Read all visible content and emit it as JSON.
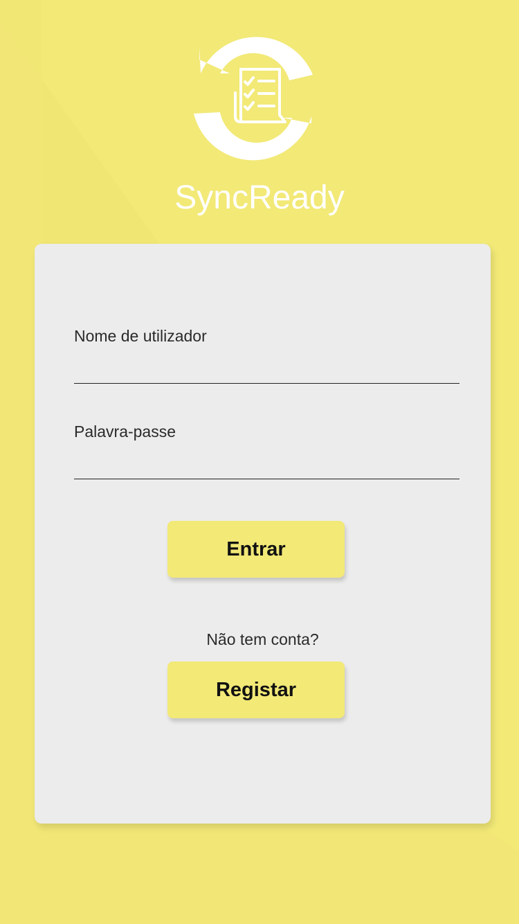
{
  "app": {
    "name": "SyncReady",
    "logo_icon": "sync-checklist-icon"
  },
  "login": {
    "username_label": "Nome de utilizador",
    "username_value": "",
    "password_label": "Palavra-passe",
    "password_value": "",
    "submit_label": "Entrar",
    "no_account_text": "Não tem conta?",
    "register_label": "Registar"
  },
  "colors": {
    "background": "#f2e977",
    "card": "#ececec",
    "button": "#f2e977",
    "logo": "#ffffff"
  }
}
